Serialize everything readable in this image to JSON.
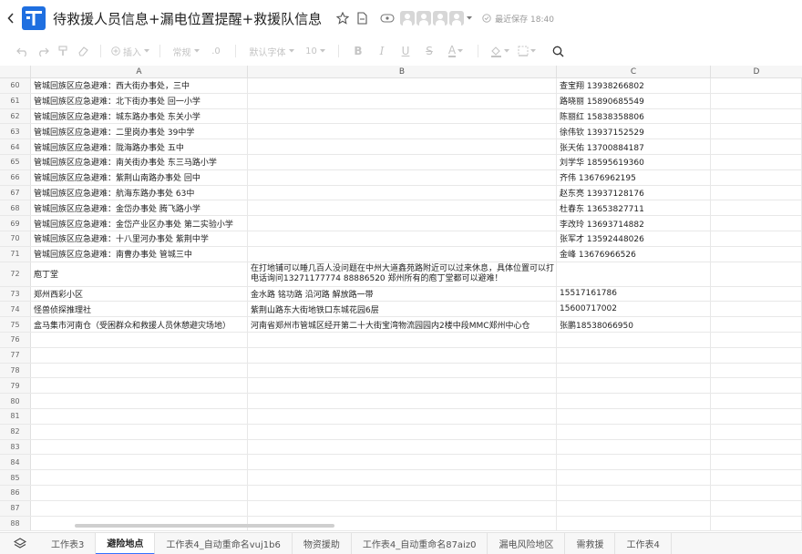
{
  "header": {
    "title": "待救援人员信息+漏电位置提醒+救援队信息",
    "save_status": "最近保存 18:40"
  },
  "toolbar": {
    "insert_label": "插入",
    "format_label": "常规",
    "decimal_label": ".0",
    "font_label": "默认字体",
    "font_size": "10",
    "bold_label": "B",
    "italic_label": "I",
    "underline_label": "U",
    "strike_label": "S",
    "font_color_label": "A"
  },
  "columns": [
    "A",
    "B",
    "C",
    "D"
  ],
  "rows": [
    {
      "n": "60",
      "a": "管城回族区应急避难：西大街办事处，三中",
      "b": "",
      "c": "查宝翔 13938266802"
    },
    {
      "n": "61",
      "a": "管城回族区应急避难：北下街办事处 回一小学",
      "b": "",
      "c": "路晓丽 15890685549"
    },
    {
      "n": "62",
      "a": "管城回族区应急避难：城东路办事处 东关小学",
      "b": "",
      "c": "陈丽红 15838358806"
    },
    {
      "n": "63",
      "a": "管城回族区应急避难：二里岗办事处 39中学",
      "b": "",
      "c": "徐伟钦 13937152529"
    },
    {
      "n": "64",
      "a": "管城回族区应急避难：陇海路办事处 五中",
      "b": "",
      "c": "张天佑 13700884187"
    },
    {
      "n": "65",
      "a": "管城回族区应急避难：南关街办事处 东三马路小学",
      "b": "",
      "c": "刘学华 18595619360"
    },
    {
      "n": "66",
      "a": "管城回族区应急避难：紫荆山南路办事处 回中",
      "b": "",
      "c": "齐伟 13676962195"
    },
    {
      "n": "67",
      "a": "管城回族区应急避难：航海东路办事处 63中",
      "b": "",
      "c": "赵东亮 13937128176"
    },
    {
      "n": "68",
      "a": "管城回族区应急避难：金岱办事处 腾飞路小学",
      "b": "",
      "c": "杜春东 13653827711"
    },
    {
      "n": "69",
      "a": "管城回族区应急避难：金岱产业区办事处 第二实验小学",
      "b": "",
      "c": "李改玲 13693714882"
    },
    {
      "n": "70",
      "a": "管城回族区应急避难：十八里河办事处 紫荆中学",
      "b": "",
      "c": "张军才 13592448026"
    },
    {
      "n": "71",
      "a": "管城回族区应急避难：南曹办事处 管城三中",
      "b": "",
      "c": "金峰 13676966526"
    },
    {
      "n": "72",
      "a": "庖丁堂",
      "b": "在打地铺可以睡几百人没问题在中州大道鑫苑路附近可以过来休息，具体位置可以打电话询问13271177774  88886520  郑州所有的庖丁堂都可以避难！",
      "c": "",
      "tall": true
    },
    {
      "n": "73",
      "a": "郑州西彩小区",
      "b": "金水路 铭功路 沿河路 解放路一带",
      "c": "15517161786"
    },
    {
      "n": "74",
      "a": "怪兽侦探推理社",
      "b": "紫荆山路东大街地铁口东城花园6层",
      "c": "15600717002"
    },
    {
      "n": "75",
      "a": "盒马集市河南仓（受困群众和救援人员休憩避灾场地）",
      "b": "河南省郑州市管城区经开第二十大街宝湾物流园园内2楼中段MMC郑州中心仓",
      "c": "张鹏18538066950"
    },
    {
      "n": "76",
      "a": "",
      "b": "",
      "c": ""
    },
    {
      "n": "77",
      "a": "",
      "b": "",
      "c": ""
    },
    {
      "n": "78",
      "a": "",
      "b": "",
      "c": ""
    },
    {
      "n": "79",
      "a": "",
      "b": "",
      "c": ""
    },
    {
      "n": "80",
      "a": "",
      "b": "",
      "c": ""
    },
    {
      "n": "81",
      "a": "",
      "b": "",
      "c": ""
    },
    {
      "n": "82",
      "a": "",
      "b": "",
      "c": ""
    },
    {
      "n": "83",
      "a": "",
      "b": "",
      "c": ""
    },
    {
      "n": "84",
      "a": "",
      "b": "",
      "c": ""
    },
    {
      "n": "85",
      "a": "",
      "b": "",
      "c": ""
    },
    {
      "n": "86",
      "a": "",
      "b": "",
      "c": ""
    },
    {
      "n": "87",
      "a": "",
      "b": "",
      "c": ""
    },
    {
      "n": "88",
      "a": "",
      "b": "",
      "c": ""
    }
  ],
  "sheet_tabs": [
    {
      "label": "工作表3",
      "active": false
    },
    {
      "label": "避险地点",
      "active": true
    },
    {
      "label": "工作表4_自动重命名vuj1b6",
      "active": false
    },
    {
      "label": "物资援助",
      "active": false
    },
    {
      "label": "工作表4_自动重命名87aiz0",
      "active": false
    },
    {
      "label": "漏电风险地区",
      "active": false
    },
    {
      "label": "需救援",
      "active": false
    },
    {
      "label": "工作表4",
      "active": false
    }
  ]
}
